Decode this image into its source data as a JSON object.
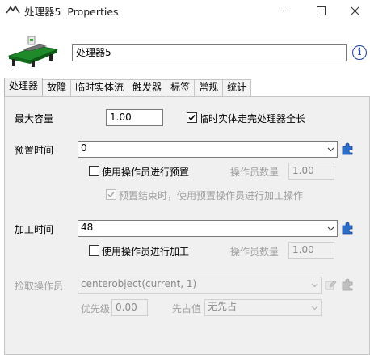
{
  "window": {
    "title": "处理器5  Properties"
  },
  "header": {
    "name_value": "处理器5",
    "info_glyph": "i",
    "object_icon": "conveyor-processor-icon"
  },
  "tabs": [
    {
      "label": "处理器"
    },
    {
      "label": "故障"
    },
    {
      "label": "临时实体流"
    },
    {
      "label": "触发器"
    },
    {
      "label": "标签"
    },
    {
      "label": "常规"
    },
    {
      "label": "统计"
    }
  ],
  "form": {
    "max_content_label": "最大容量",
    "max_content_value": "1.00",
    "flow_full_label": "临时实体走完处理器全长",
    "setup_time_label": "预置时间",
    "setup_time_value": "0",
    "use_operator_setup_label": "使用操作员进行预置",
    "operator_count_label_1": "操作员数量",
    "operator_count_value_1": "1.00",
    "setup_end_label": "预置结束时，使用预置操作员进行加工操作",
    "process_time_label": "加工时间",
    "process_time_value": "48",
    "use_operator_process_label": "使用操作员进行加工",
    "operator_count_label_2": "操作员数量",
    "operator_count_value_2": "1.00",
    "pick_operator_label": "捡取操作员",
    "pick_operator_value": "centerobject(current, 1)",
    "priority_label": "优先级",
    "priority_value": "0.00",
    "preempt_label": "先占值",
    "preempt_value": "无先占"
  },
  "colors": {
    "accent_blue": "#1a3f9c",
    "disabled_text": "#a0a0a0",
    "panel_bg": "#f0f0f0"
  }
}
